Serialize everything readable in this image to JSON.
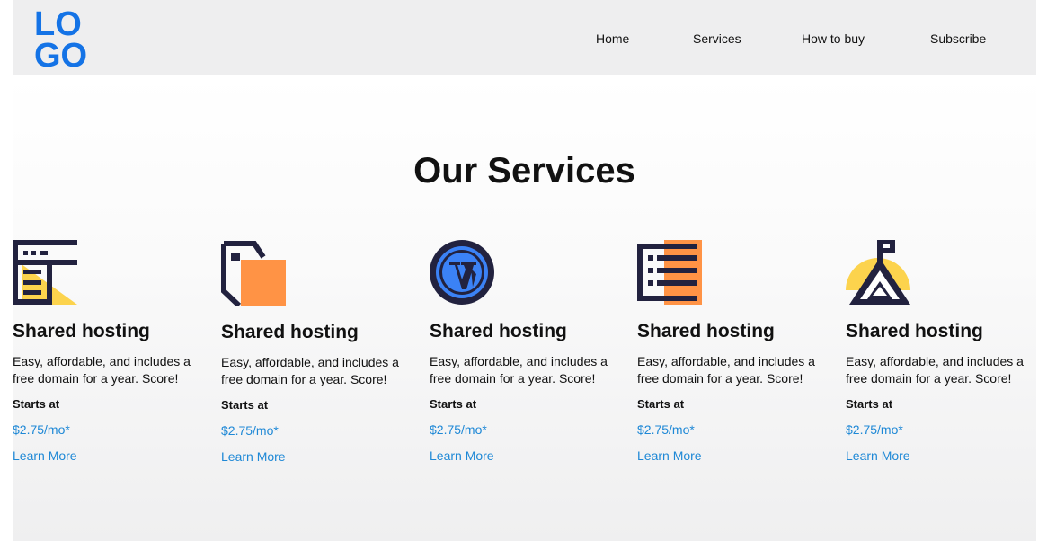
{
  "header": {
    "logo_lines": [
      "LO",
      "GO"
    ],
    "nav": [
      "Home",
      "Services",
      "How to buy",
      "Subscribe"
    ]
  },
  "main": {
    "title": "Our Services",
    "cards": [
      {
        "icon": "shared-hosting-icon",
        "title": "Shared hosting",
        "description": "Easy, affordable, and includes a free domain for a year. Score!",
        "starts_label": "Starts at",
        "price": "$2.75/mo*",
        "link": "Learn More"
      },
      {
        "icon": "document-icon",
        "title": "Shared hosting",
        "description": "Easy, affordable, and includes a free domain for a year. Score!",
        "starts_label": "Starts at",
        "price": "$2.75/mo*",
        "link": "Learn More"
      },
      {
        "icon": "wordpress-icon",
        "title": "Shared hosting",
        "description": "Easy, affordable, and includes a free domain for a year. Score!",
        "starts_label": "Starts at",
        "price": "$2.75/mo*",
        "link": "Learn More"
      },
      {
        "icon": "server-icon",
        "title": "Shared hosting",
        "description": "Easy, affordable, and includes a free domain for a year. Score!",
        "starts_label": "Starts at",
        "price": "$2.75/mo*",
        "link": "Learn More"
      },
      {
        "icon": "mountain-flag-icon",
        "title": "Shared hosting",
        "description": "Easy, affordable, and includes a free domain for a year. Score!",
        "starts_label": "Starts at",
        "price": "$2.75/mo*",
        "link": "Learn More"
      }
    ]
  },
  "colors": {
    "logo": "#1473e6",
    "link": "#1e88d6",
    "icon_dark": "#22223f",
    "icon_yellow": "#fcd34d",
    "icon_orange": "#ff9345",
    "wp_blue": "#3b82f6"
  }
}
